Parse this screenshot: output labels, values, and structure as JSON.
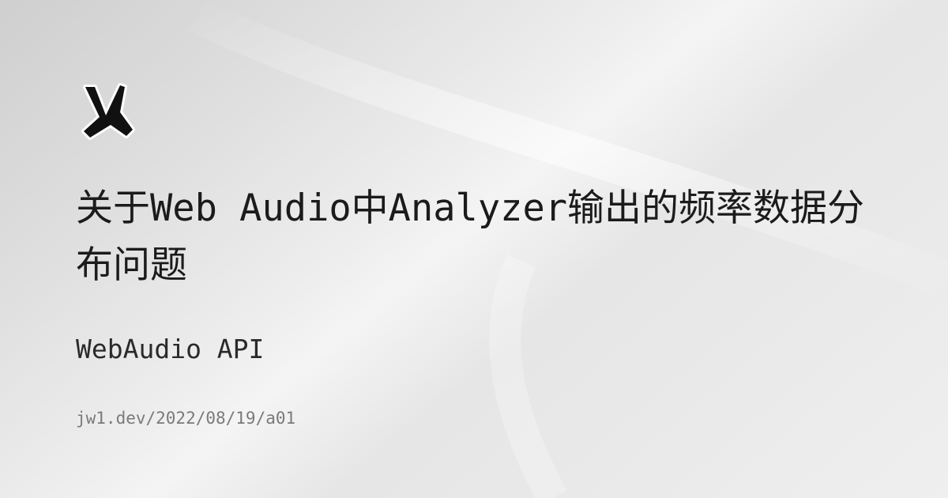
{
  "post": {
    "title": "关于Web Audio中Analyzer输出的频率数据分布问题",
    "tag": "WebAudio API",
    "url": "jw1.dev/2022/08/19/a01"
  },
  "brand": {
    "logo_icon": "bird-logo-icon"
  },
  "colors": {
    "text": "#1b1b1b",
    "muted": "#7a7a7a",
    "background": "#e6e6e6"
  }
}
